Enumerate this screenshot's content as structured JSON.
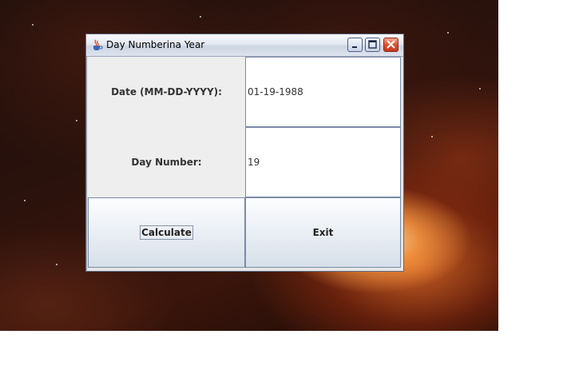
{
  "window": {
    "title": "Day Numberina Year",
    "icon": "java-coffee-icon",
    "controls": [
      "minimize-icon",
      "maximize-icon",
      "close-icon"
    ]
  },
  "form": {
    "date_label": "Date (MM-DD-YYYY):",
    "date_value": "01-19-1988",
    "day_label": "Day Number:",
    "day_value": "19"
  },
  "buttons": {
    "calculate_label": "Calculate",
    "exit_label": "Exit"
  },
  "colors": {
    "close_button": "#dd4a2b",
    "titlebar": "#dde3ee",
    "label_panel": "#eeeeee"
  }
}
